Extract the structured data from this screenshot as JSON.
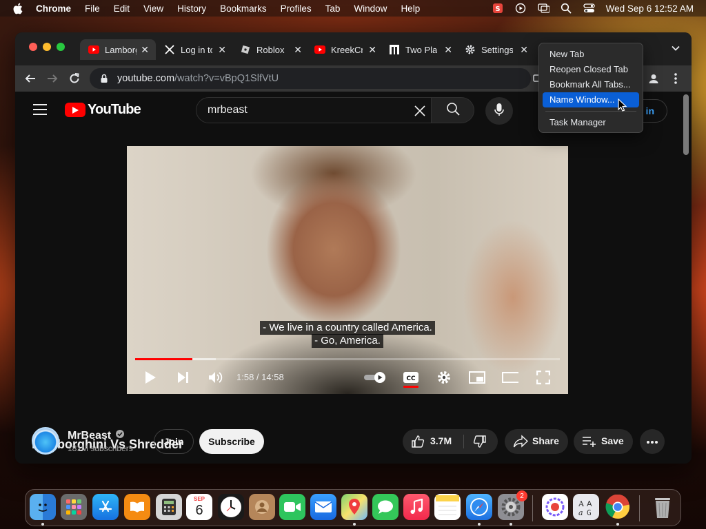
{
  "menubar": {
    "app": "Chrome",
    "items": [
      "File",
      "Edit",
      "View",
      "History",
      "Bookmarks",
      "Profiles",
      "Tab",
      "Window",
      "Help"
    ],
    "clock": "Wed Sep 6  12:52 AM"
  },
  "tabs": [
    {
      "title": "Lamborg",
      "favicon": "youtube-icon",
      "active": true
    },
    {
      "title": "Log in to",
      "favicon": "x-icon",
      "active": false
    },
    {
      "title": "Roblox",
      "favicon": "roblox-icon",
      "active": false
    },
    {
      "title": "KreekCr",
      "favicon": "youtube-icon",
      "active": false
    },
    {
      "title": "Two Pla",
      "favicon": "two-players-icon",
      "active": false
    },
    {
      "title": "Settings",
      "favicon": "gear-icon",
      "active": false
    }
  ],
  "omnibox": {
    "host": "youtube.com",
    "path": "/watch?v=vBpQ1SlfVtU"
  },
  "context_menu": {
    "items": [
      "New Tab",
      "Reopen Closed Tab",
      "Bookmark All Tabs...",
      "Name Window...",
      "Task Manager"
    ],
    "highlighted": "Name Window..."
  },
  "youtube": {
    "logo_text": "YouTube",
    "search_value": "mrbeast",
    "signin_label": "n in",
    "video": {
      "caption_line1": "- We live in a country called America.",
      "caption_line2": "- Go, America.",
      "time": "1:58 / 14:58",
      "played_fraction": 0.135,
      "buffered_fraction": 0.19
    },
    "title": "Lamborghini Vs Shredder",
    "channel": {
      "name": "MrBeast",
      "subscribers": "181M subscribers",
      "join_label": "Join",
      "subscribe_label": "Subscribe"
    },
    "actions": {
      "likes": "3.7M",
      "share_label": "Share",
      "save_label": "Save"
    }
  },
  "dock": {
    "calendar_month": "SEP",
    "calendar_day": "6",
    "settings_badge": "2"
  },
  "colors": {
    "youtube_red": "#ff0000",
    "menu_highlight": "#0a5fd6",
    "link_blue": "#3ea6ff"
  }
}
